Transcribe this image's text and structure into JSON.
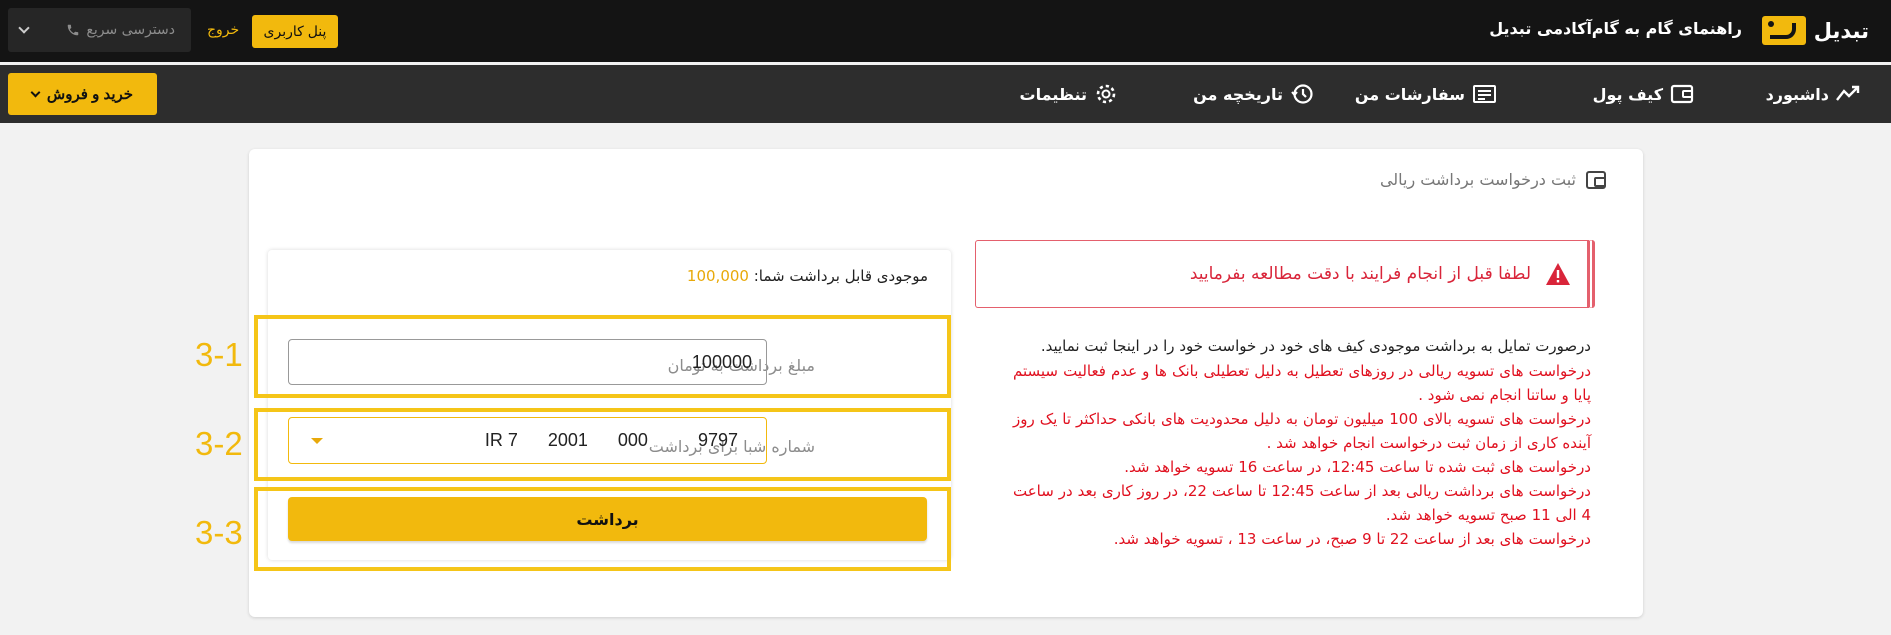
{
  "header": {
    "logo_text": "تبدیل",
    "links": [
      "راهنمای گام به گام",
      "آکادمی تبدیل"
    ],
    "panel_button": "پنل کاربری",
    "exit_link": "خروج",
    "quick_access": "دسترسی سریع"
  },
  "nav": {
    "items": [
      {
        "label": "داشبورد",
        "icon": "trend-icon"
      },
      {
        "label": "کیف پول",
        "icon": "wallet-icon"
      },
      {
        "label": "سفارشات من",
        "icon": "orders-icon"
      },
      {
        "label": "تاریخچه من",
        "icon": "history-icon"
      },
      {
        "label": "تنظیمات",
        "icon": "gear-icon"
      }
    ],
    "trade_button": "خرید و فروش"
  },
  "page": {
    "title": "ثبت درخواست برداشت ریالی",
    "alert": "لطفا قبل از انجام فرایند با دقت مطالعه بفرمایید",
    "info_main": "درصورت تمایل به برداشت موجودی کیف های خود در خواست خود را در اینجا ثبت نمایید.",
    "info_notes": [
      "درخواست های تسویه ریالی در روزهای تعطیل به دلیل تعطیلی بانک ها و عدم فعالیت سیستم پایا و ساتنا انجام نمی شود .",
      "درخواست های تسویه بالای 100 میلیون تومان به دلیل محدودیت های بانکی حداکثر تا یک روز آینده کاری از زمان ثبت درخواست انجام خواهد شد .",
      "درخواست های ثبت شده تا ساعت 12:45، در ساعت 16 تسویه خواهد شد.",
      "درخواست های برداشت ریالی بعد از ساعت 12:45 تا ساعت 22، در روز کاری بعد در ساعت 4 الی 11 صبح تسویه خواهد شد.",
      "درخواست های بعد از ساعت 22 تا 9 صبح، در ساعت 13 ، تسویه خواهد شد."
    ]
  },
  "form": {
    "balance_label": "موجودی قابل برداشت شما:",
    "balance_value": "100,000",
    "amount_label": "مبلغ برداشت به تومان",
    "amount_value": "100000",
    "sheba_label": "شماره شبا برای برداشت",
    "sheba_value": "IR 7      2001      000          9797",
    "submit": "برداشت"
  },
  "annotations": [
    "3-1",
    "3-2",
    "3-3"
  ],
  "colors": {
    "accent": "#f2b90d",
    "danger": "#e0101f",
    "topbar": "#141414",
    "navbar": "#2d2d2d"
  }
}
